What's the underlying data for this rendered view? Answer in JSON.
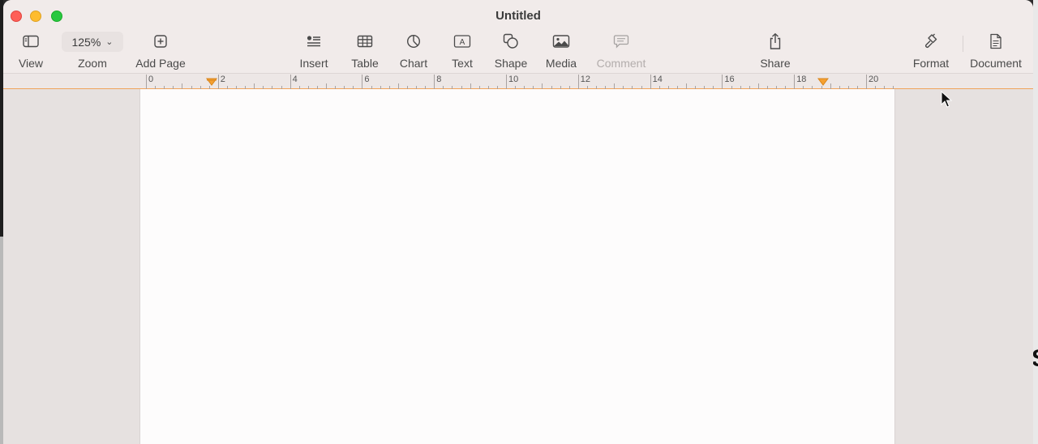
{
  "window": {
    "title": "Untitled"
  },
  "toolbar": {
    "view": {
      "label": "View",
      "icon": "sidebar-icon"
    },
    "zoom": {
      "value": "125%",
      "label": "Zoom"
    },
    "add_page": {
      "label": "Add Page",
      "icon": "plus-square-icon"
    },
    "insert": {
      "label": "Insert",
      "icon": "insert-list-icon"
    },
    "table": {
      "label": "Table",
      "icon": "table-icon"
    },
    "chart": {
      "label": "Chart",
      "icon": "pie-chart-icon"
    },
    "text": {
      "label": "Text",
      "icon": "text-box-icon"
    },
    "shape": {
      "label": "Shape",
      "icon": "shape-icon"
    },
    "media": {
      "label": "Media",
      "icon": "image-icon"
    },
    "comment": {
      "label": "Comment",
      "icon": "comment-icon",
      "disabled": true
    },
    "share": {
      "label": "Share",
      "icon": "share-icon"
    },
    "format": {
      "label": "Format",
      "icon": "paintbrush-icon"
    },
    "document": {
      "label": "Document",
      "icon": "document-icon"
    }
  },
  "ruler": {
    "labels": [
      "0",
      "2",
      "4",
      "6",
      "8",
      "10",
      "12",
      "14",
      "16",
      "18",
      "20"
    ],
    "accent_color": "#f5a030"
  },
  "desktop": {
    "glyph": "S"
  },
  "colors": {
    "close": "#fe5f57",
    "minimize": "#febc2e",
    "maximize": "#28c840"
  }
}
